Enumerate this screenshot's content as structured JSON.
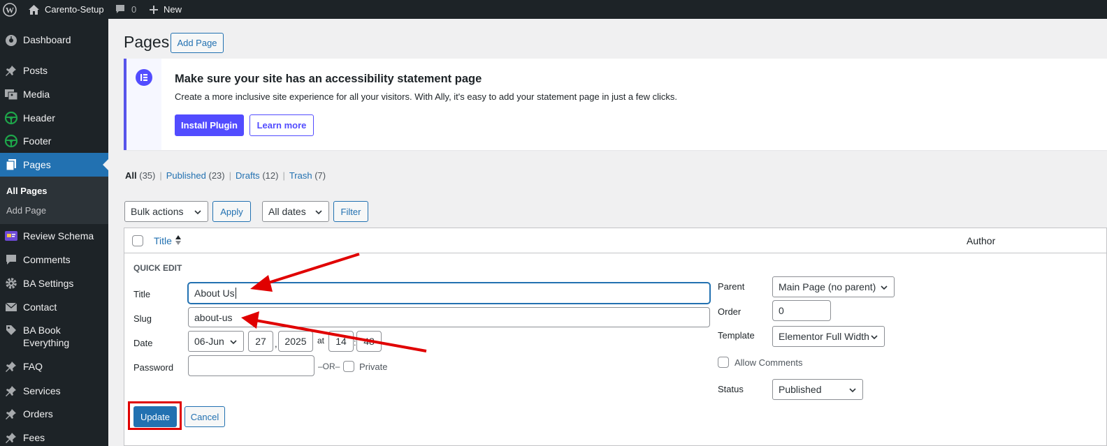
{
  "adminbar": {
    "site_name": "Carento-Setup",
    "comments_count": "0",
    "new_label": "New"
  },
  "sidebar": {
    "items": [
      {
        "label": "Dashboard",
        "icon": "dashboard-icon"
      },
      {
        "label": "Posts",
        "icon": "pin-icon"
      },
      {
        "label": "Media",
        "icon": "media-icon"
      },
      {
        "label": "Header",
        "icon": "steering-wheel-icon"
      },
      {
        "label": "Footer",
        "icon": "steering-wheel-icon"
      },
      {
        "label": "Pages",
        "icon": "pages-icon"
      },
      {
        "label": "Review Schema",
        "icon": "review-schema-icon"
      },
      {
        "label": "Comments",
        "icon": "comment-icon"
      },
      {
        "label": "BA Settings",
        "icon": "gear-icon"
      },
      {
        "label": "Contact",
        "icon": "envelope-icon"
      },
      {
        "label": "BA Book Everything",
        "line1": "BA Book",
        "line2": "Everything",
        "icon": "tag-icon"
      },
      {
        "label": "FAQ",
        "icon": "pin-icon"
      },
      {
        "label": "Services",
        "icon": "pin-icon"
      },
      {
        "label": "Orders",
        "icon": "pin-icon"
      },
      {
        "label": "Fees",
        "icon": "pin-icon"
      }
    ],
    "submenu": {
      "all_pages": "All Pages",
      "add_page": "Add Page"
    }
  },
  "header": {
    "title": "Pages",
    "add_button": "Add Page"
  },
  "notice": {
    "title": "Make sure your site has an accessibility statement page",
    "text": "Create a more inclusive site experience for all your visitors. With Ally, it's easy to add your statement page in just a few clicks.",
    "install_button": "Install Plugin",
    "learn_button": "Learn more",
    "accent_color": "#524cff"
  },
  "filters": {
    "views": [
      {
        "label": "All",
        "count": "(35)"
      },
      {
        "label": "Published",
        "count": "(23)"
      },
      {
        "label": "Drafts",
        "count": "(12)"
      },
      {
        "label": "Trash",
        "count": "(7)"
      }
    ],
    "bulk_actions": "Bulk actions",
    "apply": "Apply",
    "dates": "All dates",
    "filter": "Filter"
  },
  "table": {
    "col_title": "Title",
    "col_author": "Author"
  },
  "quick_edit": {
    "heading": "QUICK EDIT",
    "title_label": "Title",
    "title_value": "About Us",
    "slug_label": "Slug",
    "slug_value": "about-us",
    "date_label": "Date",
    "month": "06-Jun",
    "day": "27",
    "year": "2025",
    "at": "at",
    "hour": "14",
    "minute": "48",
    "password_label": "Password",
    "or_text": "–OR–",
    "private_label": "Private",
    "parent_label": "Parent",
    "parent_value": "Main Page (no parent)",
    "order_label": "Order",
    "order_value": "0",
    "template_label": "Template",
    "template_value": "Elementor Full Width",
    "allow_comments": "Allow Comments",
    "status_label": "Status",
    "status_value": "Published",
    "update_button": "Update",
    "cancel_button": "Cancel"
  },
  "colors": {
    "primary": "#2271b1",
    "annotation": "#e00000",
    "sidebar_bg": "#1d2327"
  }
}
